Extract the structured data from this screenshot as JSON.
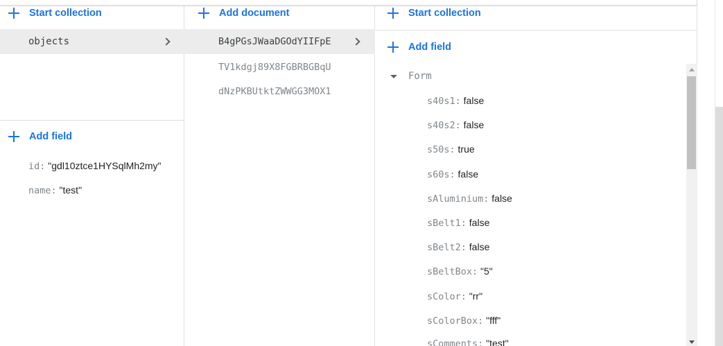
{
  "collections": {
    "start_collection_label": "Start collection",
    "items": [
      {
        "label": "objects"
      }
    ]
  },
  "parent_doc_fields": {
    "add_field_label": "Add field",
    "fields": [
      {
        "key": "id:",
        "value": "\"gdl10ztce1HYSqlMh2my\""
      },
      {
        "key": "name:",
        "value": "\"test\""
      }
    ]
  },
  "documents": {
    "add_document_label": "Add document",
    "items": [
      {
        "label": "B4gPGsJWaaDGOdYIIFpE"
      },
      {
        "label": "TV1kdgj89X8FGBRBGBqU"
      },
      {
        "label": "dNzPKBUtktZWWGG3MOX1"
      }
    ]
  },
  "document_panel": {
    "start_collection_label": "Start collection",
    "add_field_label": "Add field",
    "map_key": "Form",
    "fields": [
      {
        "key": "s40s1:",
        "value": "false"
      },
      {
        "key": "s40s2:",
        "value": "false"
      },
      {
        "key": "s50s:",
        "value": "true"
      },
      {
        "key": "s60s:",
        "value": "false"
      },
      {
        "key": "sAluminium:",
        "value": "false"
      },
      {
        "key": "sBelt1:",
        "value": "false"
      },
      {
        "key": "sBelt2:",
        "value": "false"
      },
      {
        "key": "sBeltBox:",
        "value": "\"5\""
      },
      {
        "key": "sColor:",
        "value": "\"rr\""
      },
      {
        "key": "sColorBox:",
        "value": "\"fff\""
      },
      {
        "key": "sComments:",
        "value": "\"test\""
      }
    ]
  },
  "icons": {
    "add": "plus-icon",
    "expand": "chevron-right-icon",
    "collapse": "triangle-down-icon"
  },
  "colors": {
    "accent": "#1a73e8",
    "selected_row": "#ececec",
    "key_text": "#80868b"
  }
}
